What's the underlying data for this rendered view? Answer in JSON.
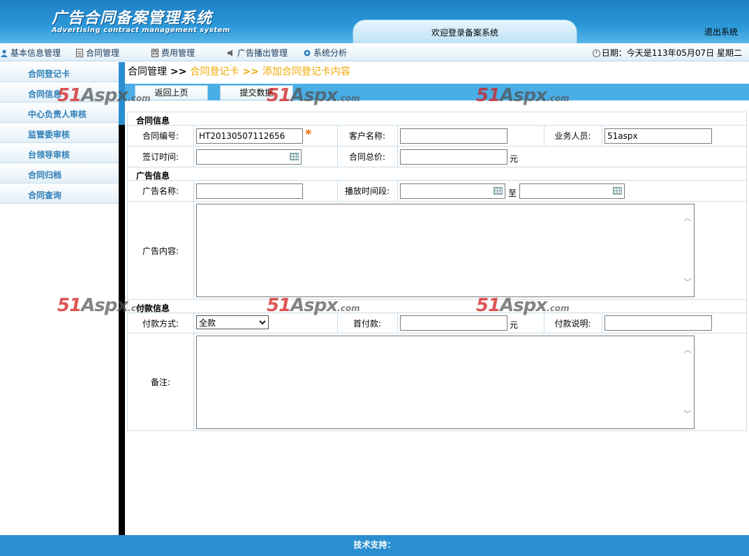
{
  "header": {
    "title": "广告合同备案管理系统",
    "subtitle": "Advertising contract management system",
    "welcome": "欢迎登录备案系统",
    "logout": "退出系统"
  },
  "menu": {
    "items": [
      {
        "label": "基本信息管理",
        "icon": "user-icon"
      },
      {
        "label": "合同管理",
        "icon": "document-icon"
      },
      {
        "label": "费用管理",
        "icon": "calculator-icon"
      },
      {
        "label": "广告播出管理",
        "icon": "speaker-icon"
      },
      {
        "label": "系统分析",
        "icon": "gear-icon"
      }
    ],
    "date_text": "日期：今天是113年05月07日 星期二"
  },
  "sidebar": {
    "items": [
      {
        "label": "合同登记卡"
      },
      {
        "label": "合同信息"
      },
      {
        "label": "中心负责人审核"
      },
      {
        "label": "监管委审核"
      },
      {
        "label": "台领导审核"
      },
      {
        "label": "合同归档"
      },
      {
        "label": "合同查询"
      }
    ]
  },
  "breadcrumb": {
    "root": "合同管理",
    "sep": ">>",
    "level1": "合同登记卡",
    "level2": "添加合同登记卡内容"
  },
  "toolbar": {
    "back_label": "返回上页",
    "submit_label": "提交数据"
  },
  "form": {
    "contract_section": "合同信息",
    "contract_no_label": "合同编号:",
    "contract_no_value": "HT20130507112656",
    "required_mark": "*",
    "customer_label": "客户名称:",
    "customer_value": "",
    "salesperson_label": "业务人员:",
    "salesperson_value": "51aspx",
    "sign_time_label": "签订时间:",
    "sign_time_value": "",
    "total_price_label": "合同总价:",
    "total_price_value": "",
    "currency_unit": "元",
    "ad_section": "广告信息",
    "ad_name_label": "广告名称:",
    "ad_name_value": "",
    "play_period_label": "播放时间段:",
    "play_start_value": "",
    "to_label": "至",
    "play_end_value": "",
    "ad_content_label": "广告内容:",
    "payment_section": "付款信息",
    "payment_method_label": "付款方式:",
    "payment_method_value": "全款",
    "first_payment_label": "首付款:",
    "first_payment_value": "",
    "payment_note_label": "付款说明:",
    "payment_note_value": "",
    "remarks_label": "备注:"
  },
  "watermark": {
    "num": "51",
    "mid": "Aspx",
    "suffix": ".com"
  },
  "footer": {
    "text": "技术支持："
  },
  "colors": {
    "header_blue": "#2b98d8",
    "sidebar_text": "#2f7fb8",
    "breadcrumb_link": "#f0a800",
    "toolbar_blue": "#4aaee6",
    "required_star": "#f07000"
  }
}
